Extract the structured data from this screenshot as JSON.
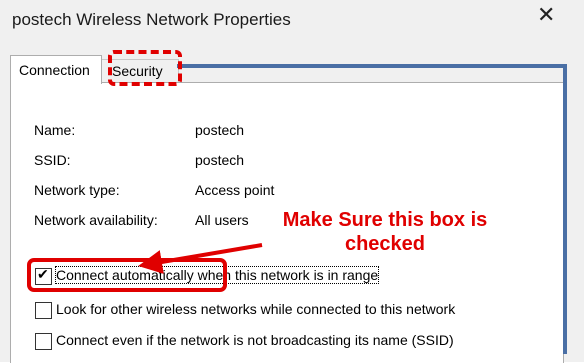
{
  "window": {
    "title": "postech Wireless Network Properties",
    "close_glyph": "✕"
  },
  "tabs": [
    {
      "label": "Connection",
      "active": true
    },
    {
      "label": "Security",
      "active": false
    }
  ],
  "details": [
    {
      "label": "Name:",
      "value": "postech"
    },
    {
      "label": "SSID:",
      "value": "postech"
    },
    {
      "label": "Network type:",
      "value": "Access point"
    },
    {
      "label": "Network availability:",
      "value": "All users"
    }
  ],
  "options": [
    {
      "label": "Connect automatically when this network is in range",
      "checked": true
    },
    {
      "label": "Look for other wireless networks while connected to this network",
      "checked": false
    },
    {
      "label": "Connect even if the network is not broadcasting its name (SSID)",
      "checked": false
    }
  ],
  "annotation": {
    "note": "Make Sure this box is checked",
    "color": "#e00000",
    "frame_color": "#4a6fa5"
  }
}
